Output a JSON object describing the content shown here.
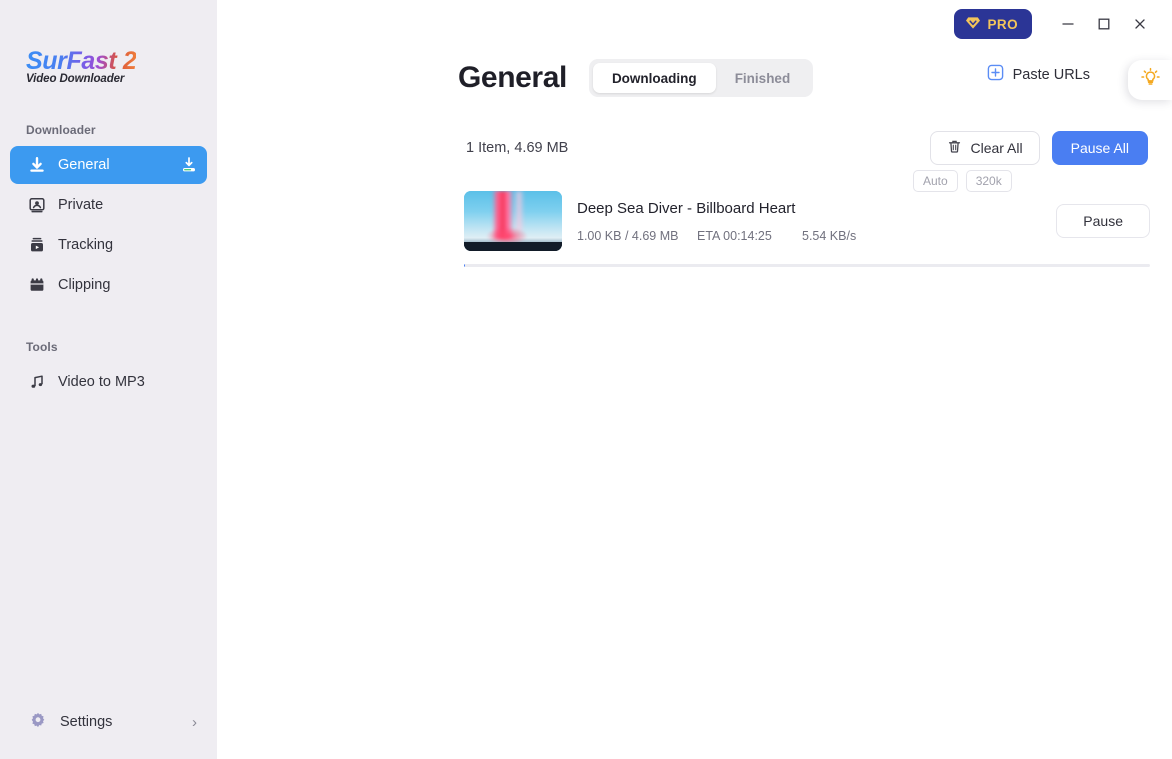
{
  "brand": {
    "name": "SurFast 2",
    "name_main": "SurFast",
    "name_num": "2",
    "subtitle": "Video Downloader"
  },
  "sidebar": {
    "sections": [
      {
        "label": "Downloader"
      },
      {
        "label": "Tools"
      }
    ],
    "downloader_label": "Downloader",
    "tools_label": "Tools",
    "items": [
      {
        "label": "General",
        "icon": "download-arrow-icon",
        "active": true,
        "trailing_icon": "download-progress-icon"
      },
      {
        "label": "Private",
        "icon": "private-person-icon",
        "active": false
      },
      {
        "label": "Tracking",
        "icon": "tracking-video-icon",
        "active": false
      },
      {
        "label": "Clipping",
        "icon": "clipping-film-icon",
        "active": false
      }
    ],
    "tools": [
      {
        "label": "Video to MP3",
        "icon": "music-note-icon"
      }
    ],
    "settings": {
      "label": "Settings",
      "icon": "gear-icon",
      "chevron": "›"
    }
  },
  "titlebar": {
    "pro_label": "PRO",
    "pro_icon": "diamond-icon",
    "minimize": "minimize-icon",
    "maximize": "maximize-icon",
    "close": "close-icon",
    "pro_bg": "#2b3596",
    "pro_fg": "#f3c55b"
  },
  "header": {
    "title": "General",
    "tabs": [
      {
        "label": "Downloading",
        "active": true
      },
      {
        "label": "Finished",
        "active": false
      }
    ],
    "paste_label": "Paste URLs",
    "paste_icon": "plus-square-icon",
    "bulb_icon": "lightbulb-icon",
    "accent": "#4a7ef2"
  },
  "toolbar": {
    "summary": "1 Item, 4.69 MB",
    "clear_all_label": "Clear All",
    "clear_all_icon": "trash-icon",
    "pause_all_label": "Pause All"
  },
  "downloads": [
    {
      "title": "Deep Sea Diver - Billboard Heart",
      "size": "1.00 KB / 4.69 MB",
      "eta": "ETA 00:14:25",
      "speed": "5.54 KB/s",
      "badges": [
        "Auto",
        "320k"
      ],
      "action_label": "Pause",
      "progress_percent": 0.02,
      "thumbnail": "album-art-thumbnail"
    }
  ]
}
